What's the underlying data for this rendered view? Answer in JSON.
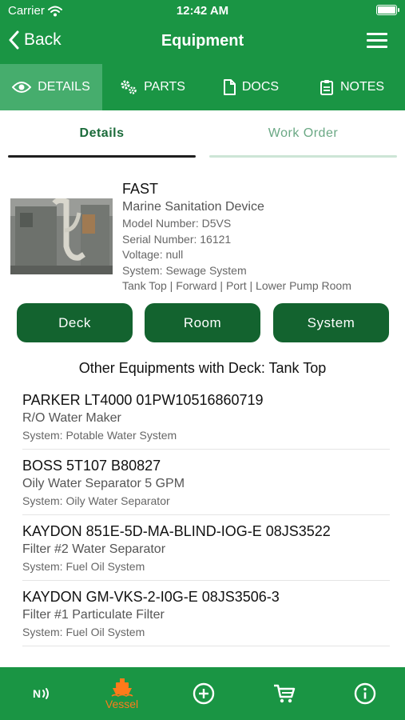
{
  "status_bar": {
    "carrier": "Carrier",
    "time": "12:42 AM"
  },
  "nav": {
    "back_label": "Back",
    "title": "Equipment"
  },
  "tabs": [
    {
      "label": "DETAILS",
      "icon": "eye-icon",
      "active": true
    },
    {
      "label": "PARTS",
      "icon": "gears-icon"
    },
    {
      "label": "DOCS",
      "icon": "document-icon"
    },
    {
      "label": "NOTES",
      "icon": "clipboard-icon"
    }
  ],
  "segments": {
    "details_label": "Details",
    "work_order_label": "Work Order",
    "active": "Details"
  },
  "equipment": {
    "name": "FAST",
    "type": "Marine Sanitation Device",
    "model": "Model Number: D5VS",
    "serial": "Serial Number: 16121",
    "voltage": "Voltage: null",
    "system": "System: Sewage System",
    "location": "Tank Top | Forward | Port | Lower Pump Room"
  },
  "buttons": {
    "deck": "Deck",
    "room": "Room",
    "system": "System"
  },
  "section_title": "Other Equipments with Deck: Tank Top",
  "list": [
    {
      "name": "PARKER LT4000 01PW10516860719",
      "type": "R/O Water Maker",
      "system": "System: Potable Water System"
    },
    {
      "name": "BOSS 5T107 B80827",
      "type": "Oily Water Separator 5 GPM",
      "system": "System: Oily Water Separator"
    },
    {
      "name": "KAYDON 851E-5D-MA-BLIND-IOG-E 08JS3522",
      "type": "Filter #2 Water Separator",
      "system": "System: Fuel Oil System"
    },
    {
      "name": "KAYDON GM-VKS-2-I0G-E 08JS3506-3",
      "type": "Filter #1 Particulate Filter",
      "system": "System: Fuel Oil System"
    }
  ],
  "tabbar": {
    "nfc_icon": "nfc-icon",
    "vessel_label": "Vessel",
    "add_icon": "add-circle-icon",
    "cart_icon": "cart-icon",
    "info_icon": "info-icon"
  },
  "colors": {
    "primary_green": "#1a9544",
    "active_tab": "#46ad6d",
    "button_dark_green": "#13632f",
    "vessel_orange": "#ff7a1a"
  }
}
